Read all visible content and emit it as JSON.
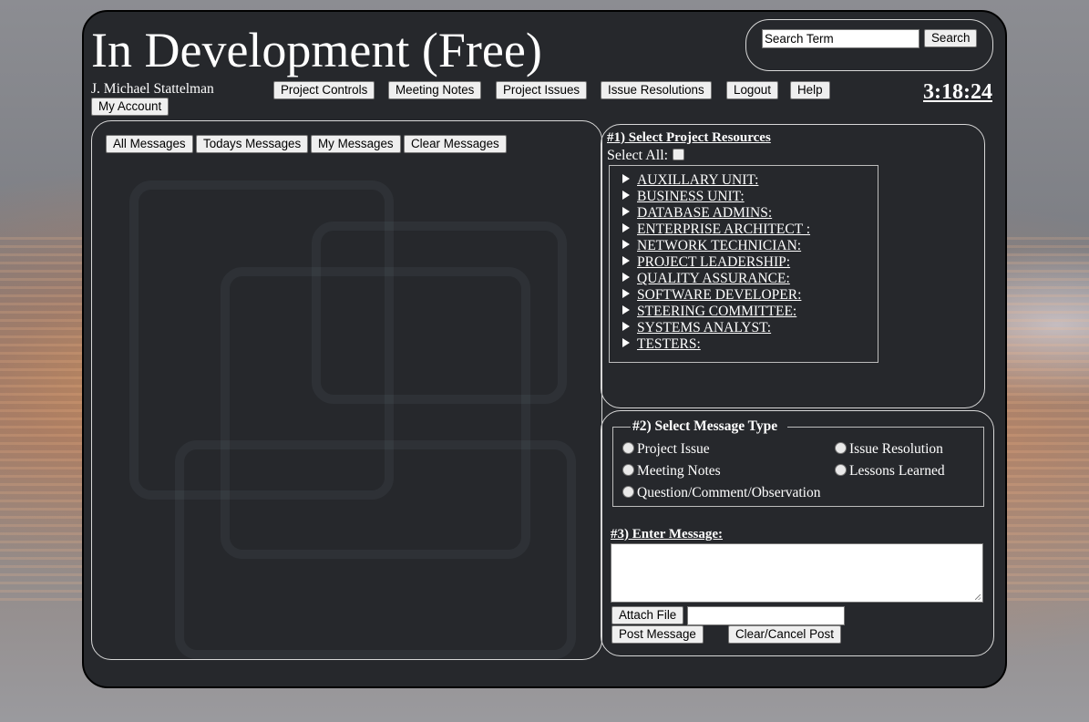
{
  "header": {
    "title": "In Development (Free)",
    "user_name": "J. Michael Stattelman",
    "clock": "3:18:24"
  },
  "search": {
    "value": "Search Term",
    "button_label": "Search"
  },
  "nav": {
    "items": [
      {
        "label": "Project Controls"
      },
      {
        "label": "Meeting Notes"
      },
      {
        "label": "Project Issues"
      },
      {
        "label": "Issue Resolutions"
      },
      {
        "label": "Logout"
      },
      {
        "label": "Help"
      }
    ],
    "my_account": "My Account"
  },
  "messages_toolbar": {
    "buttons": [
      {
        "label": "All Messages"
      },
      {
        "label": "Todays Messages"
      },
      {
        "label": "My Messages"
      },
      {
        "label": "Clear Messages"
      }
    ]
  },
  "resources": {
    "heading": "#1) Select Project Resources",
    "select_all_label": "Select All:",
    "select_all_checked": false,
    "groups": [
      {
        "label": "AUXILLARY UNIT:"
      },
      {
        "label": "BUSINESS UNIT:"
      },
      {
        "label": "DATABASE ADMINS:"
      },
      {
        "label": "ENTERPRISE ARCHITECT :"
      },
      {
        "label": "NETWORK TECHNICIAN:"
      },
      {
        "label": "PROJECT LEADERSHIP:"
      },
      {
        "label": "QUALITY ASSURANCE:"
      },
      {
        "label": "SOFTWARE DEVELOPER:"
      },
      {
        "label": "STEERING COMMITTEE:"
      },
      {
        "label": "SYSTEMS ANALYST:"
      },
      {
        "label": "TESTERS:"
      }
    ]
  },
  "message_type": {
    "legend": "#2) Select Message Type",
    "options": [
      {
        "label": "Project Issue"
      },
      {
        "label": "Issue Resolution"
      },
      {
        "label": "Meeting Notes"
      },
      {
        "label": "Lessons Learned"
      },
      {
        "label": "Question/Comment/Observation"
      }
    ]
  },
  "compose": {
    "heading": "#3) Enter Message:",
    "message_value": "",
    "attach_label": "Attach File",
    "file_value": "",
    "post_label": "Post Message",
    "cancel_label": "Clear/Cancel Post"
  },
  "colors": {
    "panel_bg": "#26282c",
    "text": "#ffffff",
    "button_bg": "#efefef",
    "border": "#d8d8d8"
  }
}
